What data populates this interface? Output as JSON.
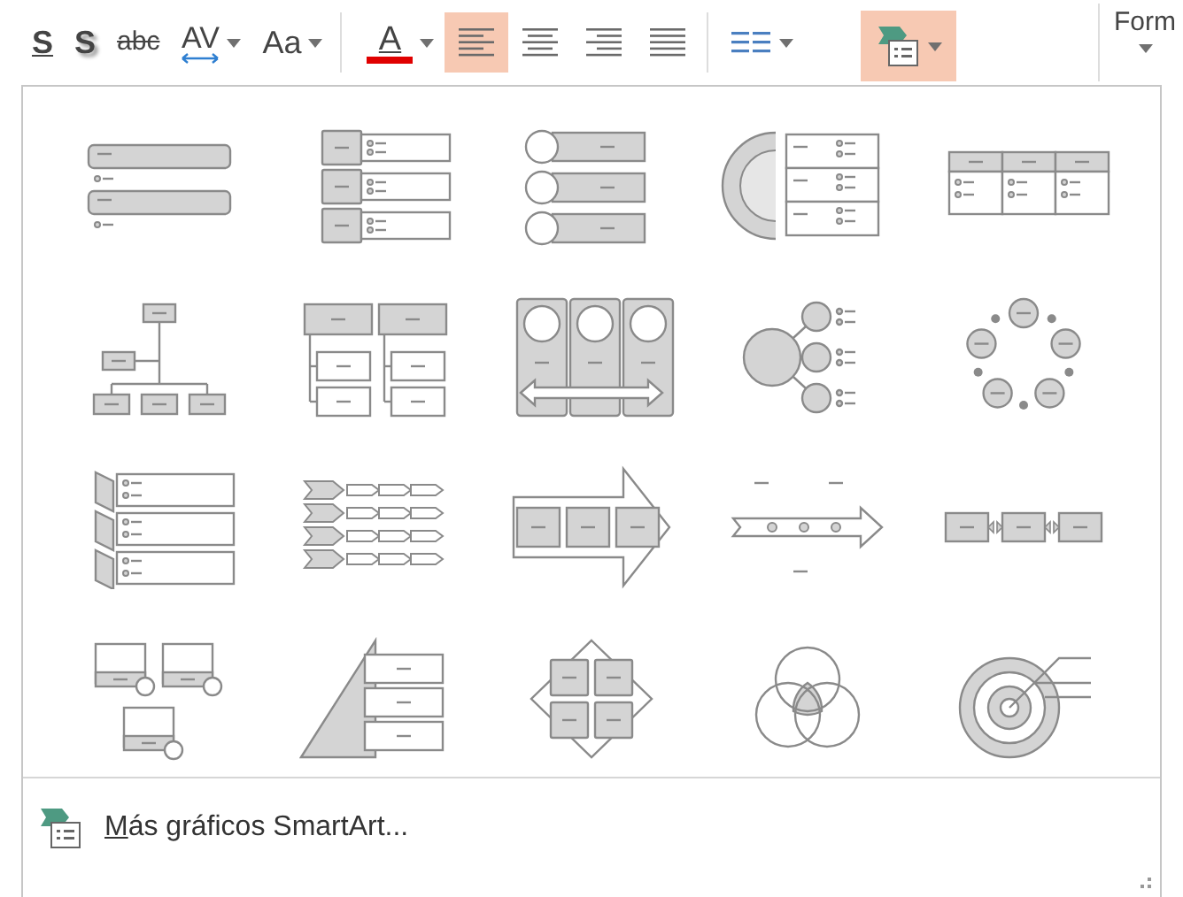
{
  "toolbar": {
    "items": [
      {
        "kind": "underline",
        "label": "S",
        "selected": false
      },
      {
        "kind": "shadow",
        "label": "S",
        "selected": false
      },
      {
        "kind": "strike",
        "label": "abc",
        "selected": false
      },
      {
        "kind": "spacing",
        "label": "AV",
        "selected": false
      },
      {
        "kind": "case",
        "label": "Aa",
        "selected": false
      },
      {
        "kind": "fontcolor",
        "label": "A",
        "selected": false
      },
      {
        "kind": "align-left",
        "selected": true
      },
      {
        "kind": "align-center",
        "selected": false
      },
      {
        "kind": "align-right",
        "selected": false
      },
      {
        "kind": "justify",
        "selected": false
      },
      {
        "kind": "columns",
        "selected": false
      },
      {
        "kind": "smartart",
        "selected": true
      },
      {
        "kind": "format",
        "label": "Form"
      }
    ]
  },
  "gallery": {
    "items": [
      {
        "kind": "bullet-list"
      },
      {
        "kind": "box-list"
      },
      {
        "kind": "circle-list"
      },
      {
        "kind": "arc-list"
      },
      {
        "kind": "table-list"
      },
      {
        "kind": "org-chart"
      },
      {
        "kind": "hierarchy-list"
      },
      {
        "kind": "circle-process"
      },
      {
        "kind": "radial-bullets"
      },
      {
        "kind": "cycle"
      },
      {
        "kind": "chevron-list"
      },
      {
        "kind": "chevron-process"
      },
      {
        "kind": "arrow-boxes"
      },
      {
        "kind": "timeline"
      },
      {
        "kind": "linked-boxes"
      },
      {
        "kind": "picture-boxes"
      },
      {
        "kind": "pyramid"
      },
      {
        "kind": "diamond-boxes"
      },
      {
        "kind": "venn"
      },
      {
        "kind": "target"
      }
    ]
  },
  "more_link": {
    "label": "Más gráficos SmartArt..."
  }
}
